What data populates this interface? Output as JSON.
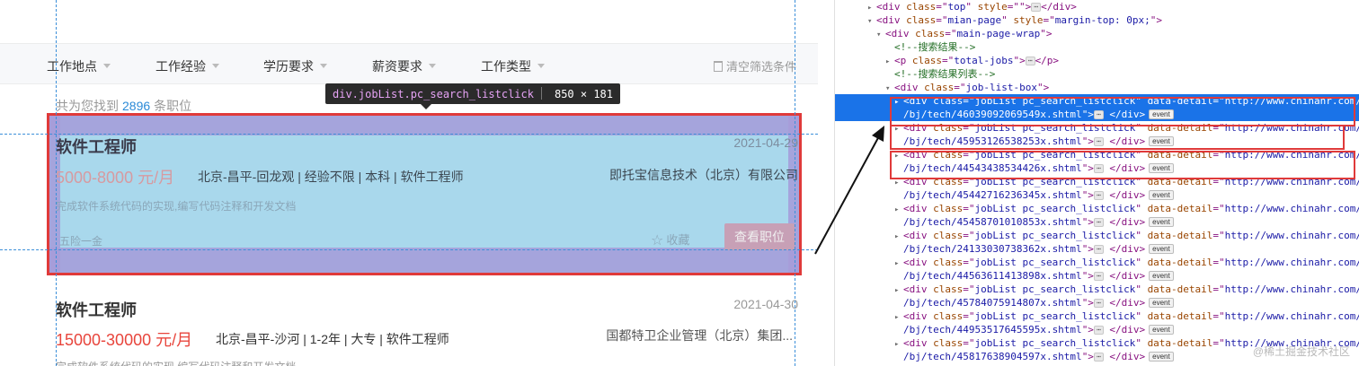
{
  "filters": {
    "items": [
      "工作地点",
      "工作经验",
      "学历要求",
      "薪资要求",
      "工作类型"
    ],
    "clear_label": "清空筛选条件"
  },
  "summary": {
    "prefix": "共为您找到",
    "count": "2896",
    "suffix": "条职位"
  },
  "tooltip": {
    "selector": "div.jobList.pc_search_listclick",
    "size": "850 × 181"
  },
  "jobs": [
    {
      "title": "软件工程师",
      "date": "2021-04-29",
      "salary": "5000-8000 元/月",
      "meta": "北京-昌平-回龙观 | 经验不限 | 本科 | 软件工程师",
      "company": "即托宝信息技术（北京）有限公司",
      "desc": "完成软件系统代码的实现,编写代码注释和开发文档",
      "tag": "五险一金",
      "fav": "收藏",
      "view": "查看职位"
    },
    {
      "title": "软件工程师",
      "date": "2021-04-30",
      "salary": "15000-30000 元/月",
      "meta": "北京-昌平-沙河 | 1-2年 | 大专 | 软件工程师",
      "company": "国都特卫企业管理（北京）集团...",
      "desc": "完成软件系统代码的实现,编写代码注释和开发文档"
    }
  ],
  "devtools": {
    "lines": [
      {
        "indent": 3,
        "tri": "▸",
        "tag": "div",
        "attrs": [
          [
            "class",
            "top"
          ],
          [
            "style",
            ""
          ]
        ],
        "ell": true,
        "close": "</div>"
      },
      {
        "indent": 3,
        "tri": "▾",
        "tag": "div",
        "attrs": [
          [
            "class",
            "mian-page"
          ],
          [
            "style",
            "margin-top: 0px;"
          ]
        ]
      },
      {
        "indent": 4,
        "tri": "▾",
        "tag": "div",
        "attrs": [
          [
            "class",
            "main-page-wrap"
          ]
        ]
      },
      {
        "indent": 5,
        "comment": "<!--搜索结果-->"
      },
      {
        "indent": 5,
        "tri": "▸",
        "tag": "p",
        "attrs": [
          [
            "class",
            "total-jobs"
          ]
        ],
        "ell": true,
        "close": "</p>"
      },
      {
        "indent": 5,
        "comment": "<!--搜索结果列表-->"
      },
      {
        "indent": 5,
        "tri": "▾",
        "tag": "div",
        "attrs": [
          [
            "class",
            "job-list-box"
          ]
        ]
      }
    ],
    "joblist_class": "jobList pc_search_listclick",
    "detail_prefix": "http://www.chinahr.com/detail",
    "detail_ids": [
      "/bj/tech/46039092069549x.shtml",
      "/bj/tech/45953126538253x.shtml",
      "/bj/tech/44543438534426x.shtml",
      "/bj/tech/45442716236345x.shtml",
      "/bj/tech/45458701010853x.shtml",
      "/bj/tech/24133030738362x.shtml",
      "/bj/tech/44563611413898x.shtml",
      "/bj/tech/45784075914807x.shtml",
      "/bj/tech/44953517645595x.shtml",
      "/bj/tech/45817638904597x.shtml"
    ],
    "event_label": "event",
    "watermark": "@稀土掘金技术社区"
  }
}
